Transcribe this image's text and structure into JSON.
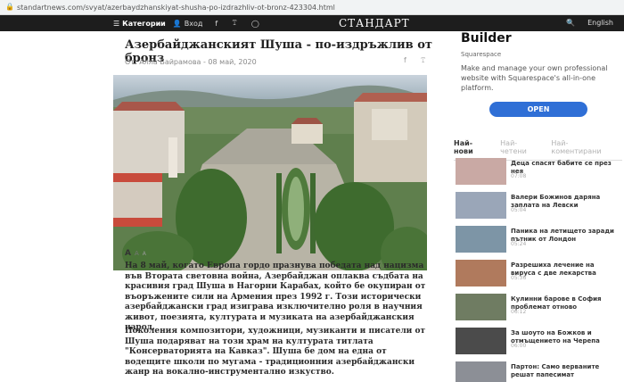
{
  "browser": {
    "url": "standartnews.com/svyat/azerbaydzhanskiyat-shusha-po-izdrazhliv-ot-bronz-423304.html"
  },
  "topnav": {
    "categories_label": "Категории",
    "login_label": "Вход",
    "logo": "СТАНДАРТ",
    "lang_label": "English"
  },
  "article": {
    "title": "Азербайджанският Шуша - по-издръжлив от бронз",
    "byline": "От: Алла Байрамова - 08 май, 2020",
    "fontsize": [
      "A",
      "A",
      "A"
    ],
    "paragraphs": [
      "На 8 май, когато Европа гордо празнува победата над нацизма във Втората световна война, Азербайджан оплаква съдбата на красивия град Шуша в Нагорни Карабах, който бе окупиран от въоръжените сили на Армения през 1992 г. Този исторически азербайджански град изиграва изключително роля в научния живот, поезията, културата и музиката на азербайджанския народ.",
      "Поколения композитори, художници, музиканти и писатели от Шуша подаряват на този храм на културата титлата \"Консерваторията на Кавказ\". Шуша бе дом на една от водещите школи по мугама - традиционния азербайджански жанр на вокално-инструментално изкуство."
    ]
  },
  "ad": {
    "title": "Builder",
    "brand": "Squarespace",
    "text": "Make and manage your own professional website with Squarespace's all-in-one platform.",
    "button": "OPEN"
  },
  "sidebar": {
    "tabs": [
      "Най-нови",
      "Най-четени",
      "Най-коментирани"
    ],
    "news": [
      {
        "title": "Деца спасят бабите се през нея",
        "time": "07:08",
        "thumb_color": "#c9a9a4"
      },
      {
        "title": "Валери Божинов даряна заплата на Левски",
        "time": "05:04",
        "thumb_color": "#9aa6b8"
      },
      {
        "title": "Паника на летището заради пътник от Лондон",
        "time": "05:24",
        "thumb_color": "#7d95a6"
      },
      {
        "title": "Разрешиха лечение на вируса с две лекарства",
        "time": "05:36",
        "thumb_color": "#b07a5d"
      },
      {
        "title": "Кулинни барове в София проблемат отново",
        "time": "06:12",
        "thumb_color": "#6f7c62"
      },
      {
        "title": "За шоуто на Божков и отмъщението на Черепа",
        "time": "06:00",
        "thumb_color": "#4b4b4b"
      },
      {
        "title": "Партон: Само верваните решат папесимат",
        "time": "",
        "thumb_color": "#8c8f96"
      }
    ]
  }
}
